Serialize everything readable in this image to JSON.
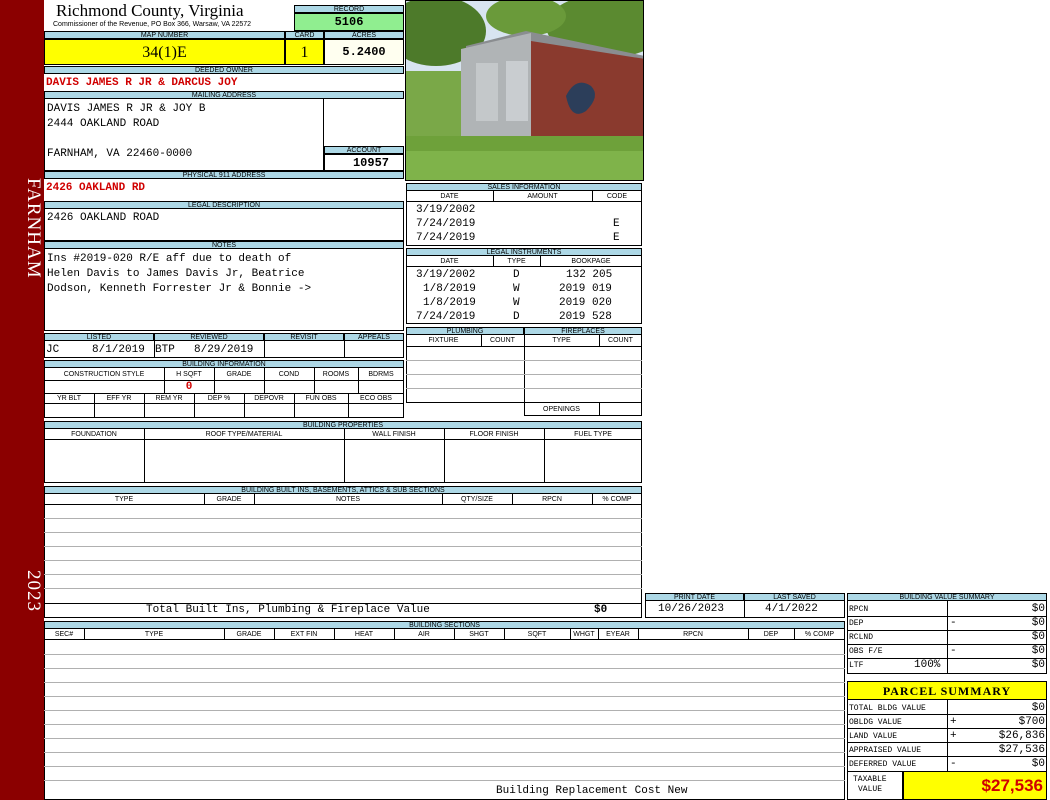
{
  "sidebar": {
    "district": "FARNHAM",
    "year": "2023"
  },
  "header": {
    "county": "Richmond County, Virginia",
    "commissioner": "Commissioner of the Revenue, PO Box 366, Warsaw, VA 22572",
    "record_label": "RECORD",
    "record": "5106",
    "map_number_label": "MAP NUMBER",
    "map_number": "34(1)E",
    "card_label": "CARD",
    "card": "1",
    "acres_label": "ACRES",
    "acres": "5.2400"
  },
  "owner": {
    "deeded_owner_label": "DEEDED OWNER",
    "deeded_owner": "DAVIS JAMES R JR & DARCUS JOY",
    "mailing_label": "MAILING ADDRESS",
    "mailing_lines": [
      "DAVIS JAMES R JR & JOY B",
      "2444 OAKLAND ROAD",
      "",
      "FARNHAM, VA 22460-0000"
    ],
    "account_label": "ACCOUNT",
    "account": "10957",
    "physical_label": "PHYSICAL 911 ADDRESS",
    "physical": "2426 OAKLAND RD",
    "legal_label": "LEGAL DESCRIPTION",
    "legal": "2426 OAKLAND ROAD",
    "notes_label": "NOTES",
    "notes_lines": [
      "Ins #2019-020 R/E aff due to death of",
      "Helen Davis to James Davis Jr, Beatrice",
      "Dodson, Kenneth Forrester Jr & Bonnie ->"
    ]
  },
  "review": {
    "listed_label": "LISTED",
    "reviewed_label": "REVIEWED",
    "revisit_label": "REVISIT",
    "appeals_label": "APPEALS",
    "listed_by": "JC",
    "listed_date": "8/1/2019",
    "reviewed_by": "BTP",
    "reviewed_date": "8/29/2019"
  },
  "building_info": {
    "title": "BUILDING INFORMATION",
    "cols1": [
      "CONSTRUCTION STYLE",
      "H SQFT",
      "GRADE",
      "COND",
      "ROOMS",
      "BDRMS"
    ],
    "hsqft": "0",
    "cols2": [
      "YR BLT",
      "EFF YR",
      "REM YR",
      "DEP %",
      "DEPOVR",
      "FUN OBS",
      "ECO OBS"
    ]
  },
  "sales": {
    "title": "SALES INFORMATION",
    "cols": [
      "DATE",
      "AMOUNT",
      "CODE"
    ],
    "rows": [
      {
        "date": "3/19/2002",
        "amount": "",
        "code": ""
      },
      {
        "date": "7/24/2019",
        "amount": "",
        "code": "E"
      },
      {
        "date": "7/24/2019",
        "amount": "",
        "code": "E"
      }
    ]
  },
  "instruments": {
    "title": "LEGAL INSTRUMENTS",
    "cols": [
      "DATE",
      "TYPE",
      "BOOKPAGE"
    ],
    "rows": [
      {
        "date": "3/19/2002",
        "type": "D",
        "book": "132 205"
      },
      {
        "date": "1/8/2019",
        "type": "W",
        "book": "2019 019"
      },
      {
        "date": "1/8/2019",
        "type": "W",
        "book": "2019 020"
      },
      {
        "date": "7/24/2019",
        "type": "D",
        "book": "2019 528"
      }
    ]
  },
  "plumbing": {
    "title": "PLUMBING",
    "cols": [
      "FIXTURE",
      "COUNT"
    ]
  },
  "fireplaces": {
    "title": "FIREPLACES",
    "cols": [
      "TYPE",
      "COUNT"
    ],
    "openings_label": "OPENINGS"
  },
  "properties": {
    "title": "BUILDING PROPERTIES",
    "cols": [
      "FOUNDATION",
      "ROOF TYPE/MATERIAL",
      "WALL FINISH",
      "FLOOR FINISH",
      "FUEL TYPE"
    ]
  },
  "builtins": {
    "title": "BUILDING BUILT INS, BASEMENTS, ATTICS & SUB SECTIONS",
    "cols": [
      "TYPE",
      "GRADE",
      "NOTES",
      "QTY/SIZE",
      "RPCN",
      "% COMP"
    ],
    "total_label": "Total Built Ins, Plumbing & Fireplace Value",
    "total_value": "$0"
  },
  "dates": {
    "print_label": "PRINT DATE",
    "print_date": "10/26/2023",
    "saved_label": "LAST SAVED",
    "saved_date": "4/1/2022"
  },
  "sections": {
    "title": "BUILDING SECTIONS",
    "cols": [
      "SEC#",
      "TYPE",
      "GRADE",
      "EXT FIN",
      "HEAT",
      "AIR",
      "SHGT",
      "SQFT",
      "WHGT",
      "EYEAR",
      "RPCN",
      "DEP",
      "% COMP"
    ],
    "footer": "Building Replacement Cost New"
  },
  "value_summary": {
    "title": "BUILDING VALUE SUMMARY",
    "rows": [
      {
        "label": "RPCN",
        "sign": "",
        "value": "$0"
      },
      {
        "label": "DEP",
        "sign": "-",
        "value": "$0"
      },
      {
        "label": "RCLND",
        "sign": "",
        "value": "$0"
      },
      {
        "label": "OBS F/E",
        "sign": "-",
        "value": "$0"
      },
      {
        "label": "LTF",
        "sign": "100%",
        "value": "$0"
      }
    ]
  },
  "parcel_summary": {
    "title": "PARCEL SUMMARY",
    "rows": [
      {
        "label": "TOTAL BLDG VALUE",
        "sign": "",
        "value": "$0"
      },
      {
        "label": "OBLDG VALUE",
        "sign": "+",
        "value": "$700"
      },
      {
        "label": "LAND VALUE",
        "sign": "+",
        "value": "$26,836"
      },
      {
        "label": "APPRAISED VALUE",
        "sign": "",
        "value": "$27,536"
      },
      {
        "label": "DEFERRED VALUE",
        "sign": "-",
        "value": "$0"
      }
    ],
    "taxable_label_1": "TAXABLE",
    "taxable_label_2": "VALUE",
    "taxable_value": "$27,536"
  },
  "colors": {
    "sidebar": "#8b0000",
    "header_fill": "#add8e6",
    "highlight": "#ffff00",
    "record_fill": "#90ee90",
    "owner_text": "#d00000"
  },
  "photo": {
    "icon": "barn-photo"
  }
}
